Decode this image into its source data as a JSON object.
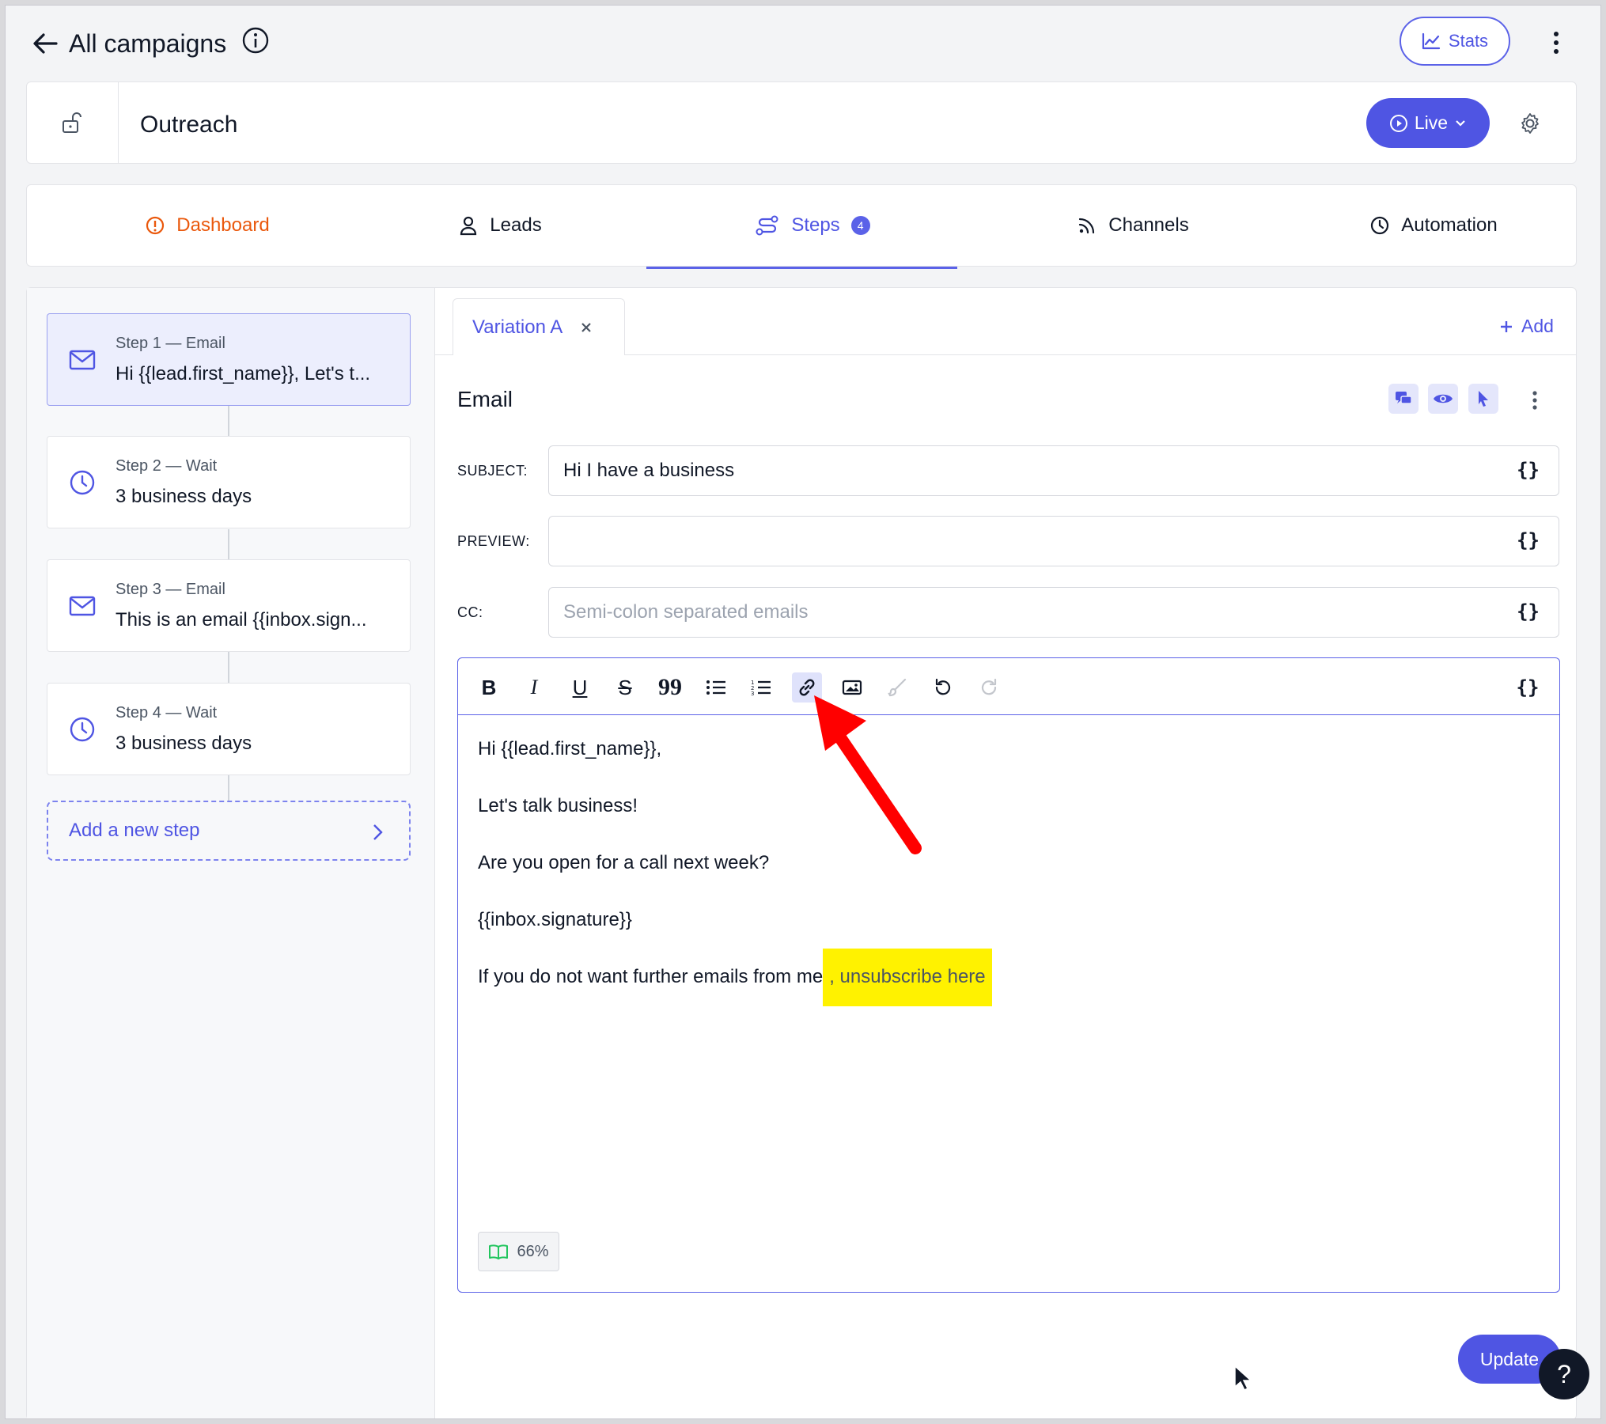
{
  "header": {
    "title": "All campaigns",
    "stats_label": "Stats"
  },
  "campaign": {
    "name": "Outreach",
    "status_label": "Live"
  },
  "tabs": [
    {
      "label": "Dashboard",
      "color": "#ea580c"
    },
    {
      "label": "Leads"
    },
    {
      "label": "Steps",
      "badge": "4",
      "active": true
    },
    {
      "label": "Channels"
    },
    {
      "label": "Automation"
    }
  ],
  "steps": [
    {
      "kicker": "Step 1 — Email",
      "text": "Hi {{lead.first_name}}, Let's t...",
      "icon": "mail-icon",
      "active": true
    },
    {
      "kicker": "Step 2 — Wait",
      "text": "3 business days",
      "icon": "clock-icon"
    },
    {
      "kicker": "Step 3 — Email",
      "text": "This is an email {{inbox.sign...",
      "icon": "mail-icon"
    },
    {
      "kicker": "Step 4 — Wait",
      "text": "3 business days",
      "icon": "clock-icon"
    }
  ],
  "add_step_label": "Add a new step",
  "variation": {
    "tab_label": "Variation A",
    "add_label": "Add"
  },
  "email": {
    "section_title": "Email",
    "subject_label": "SUBJECT:",
    "subject_value": "Hi I have a business",
    "preview_label": "PREVIEW:",
    "preview_value": "",
    "cc_label": "CC:",
    "cc_placeholder": "Semi-colon separated emails",
    "brace_glyph": "{}",
    "body": {
      "line1": "Hi {{lead.first_name}},",
      "line2": "Let's talk business!",
      "line3": "Are you open for a call next week?",
      "line4": "{{inbox.signature}}",
      "line5_prefix": "If you do not want further emails from me",
      "line5_comma": ",",
      "line5_link": " unsubscribe here"
    },
    "readability": "66%"
  },
  "toolbar": {
    "bold": "B",
    "italic": "I",
    "underline": "U",
    "strike": "S",
    "quote": "99"
  },
  "footer": {
    "update_label": "Update",
    "help_label": "?"
  },
  "colors": {
    "accent": "#4f55e3",
    "highlight": "#fff200",
    "annotation_arrow": "#ff0000"
  }
}
